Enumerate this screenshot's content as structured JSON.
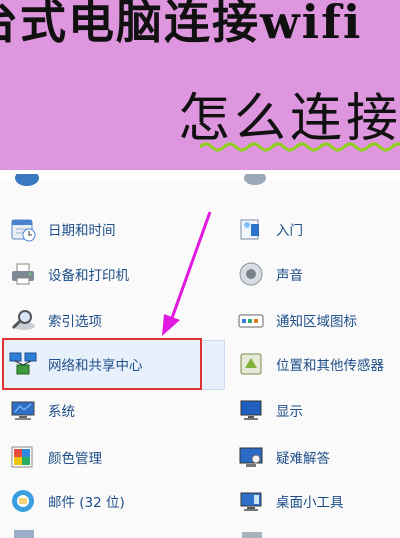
{
  "banner": {
    "title_line1": "台式电脑连接wifi",
    "title_line2": "怎么连接",
    "colors": {
      "background": "#de97de",
      "wave": "#8ed11a"
    }
  },
  "control_panel": {
    "left_items": [
      {
        "label": "日期和时间",
        "icon": "calendar-clock-icon"
      },
      {
        "label": "设备和打印机",
        "icon": "printer-icon"
      },
      {
        "label": "索引选项",
        "icon": "magnifier-index-icon"
      },
      {
        "label": "网络和共享中心",
        "icon": "network-icon"
      },
      {
        "label": "系统",
        "icon": "system-monitor-icon"
      },
      {
        "label": "颜色管理",
        "icon": "color-management-icon"
      },
      {
        "label": "邮件 (32 位)",
        "icon": "mail-icon"
      }
    ],
    "right_items": [
      {
        "label": "入门",
        "icon": "getting-started-icon"
      },
      {
        "label": "声音",
        "icon": "speaker-icon"
      },
      {
        "label": "通知区域图标",
        "icon": "notification-area-icon"
      },
      {
        "label": "位置和其他传感器",
        "icon": "location-sensor-icon"
      },
      {
        "label": "显示",
        "icon": "display-icon"
      },
      {
        "label": "疑难解答",
        "icon": "troubleshooting-icon"
      },
      {
        "label": "桌面小工具",
        "icon": "desktop-gadgets-icon"
      }
    ],
    "colors": {
      "label": "#1d4e89",
      "highlight_border": "#e03030",
      "arrow": "#e018e0"
    }
  }
}
